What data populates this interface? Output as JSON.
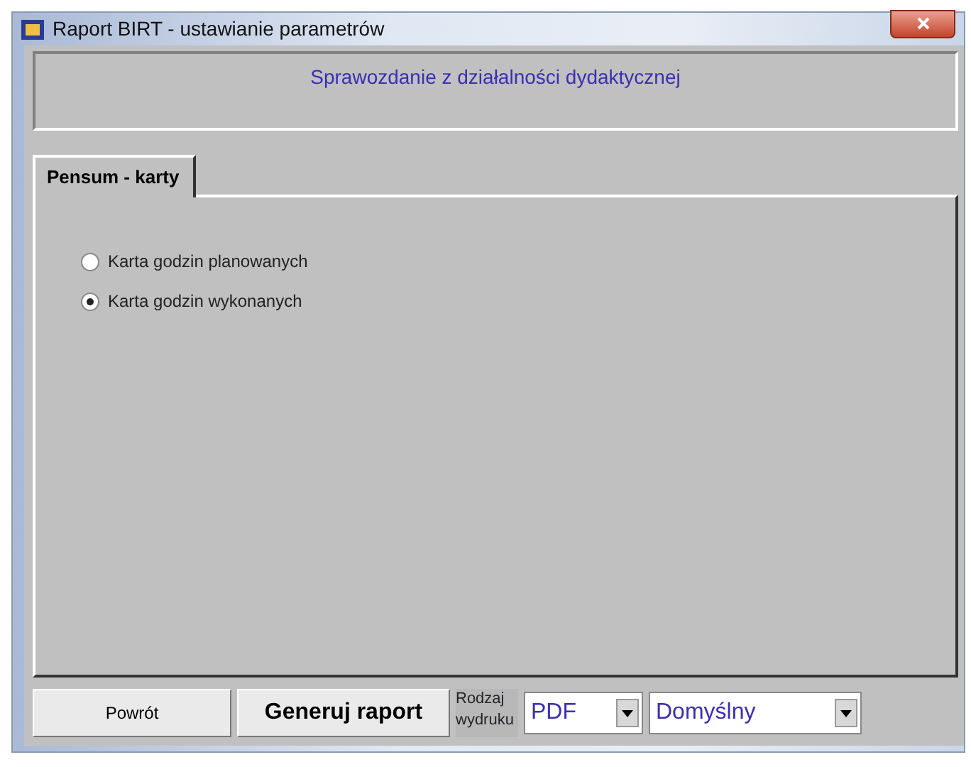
{
  "window": {
    "title": "Raport BIRT - ustawianie parametrów"
  },
  "header": {
    "title": "Sprawozdanie z działalności dydaktycznej"
  },
  "tabs": [
    {
      "label": "Pensum - karty",
      "selected": true
    }
  ],
  "options": [
    {
      "label": "Karta godzin planowanych",
      "selected": false
    },
    {
      "label": "Karta godzin wykonanych",
      "selected": true
    }
  ],
  "footer": {
    "back_button": "Powrót",
    "generate_button": "Generuj raport",
    "output_label": "Rodzaj wydruku",
    "format": {
      "value": "PDF"
    },
    "printer": {
      "value": "Domyślny"
    }
  }
}
